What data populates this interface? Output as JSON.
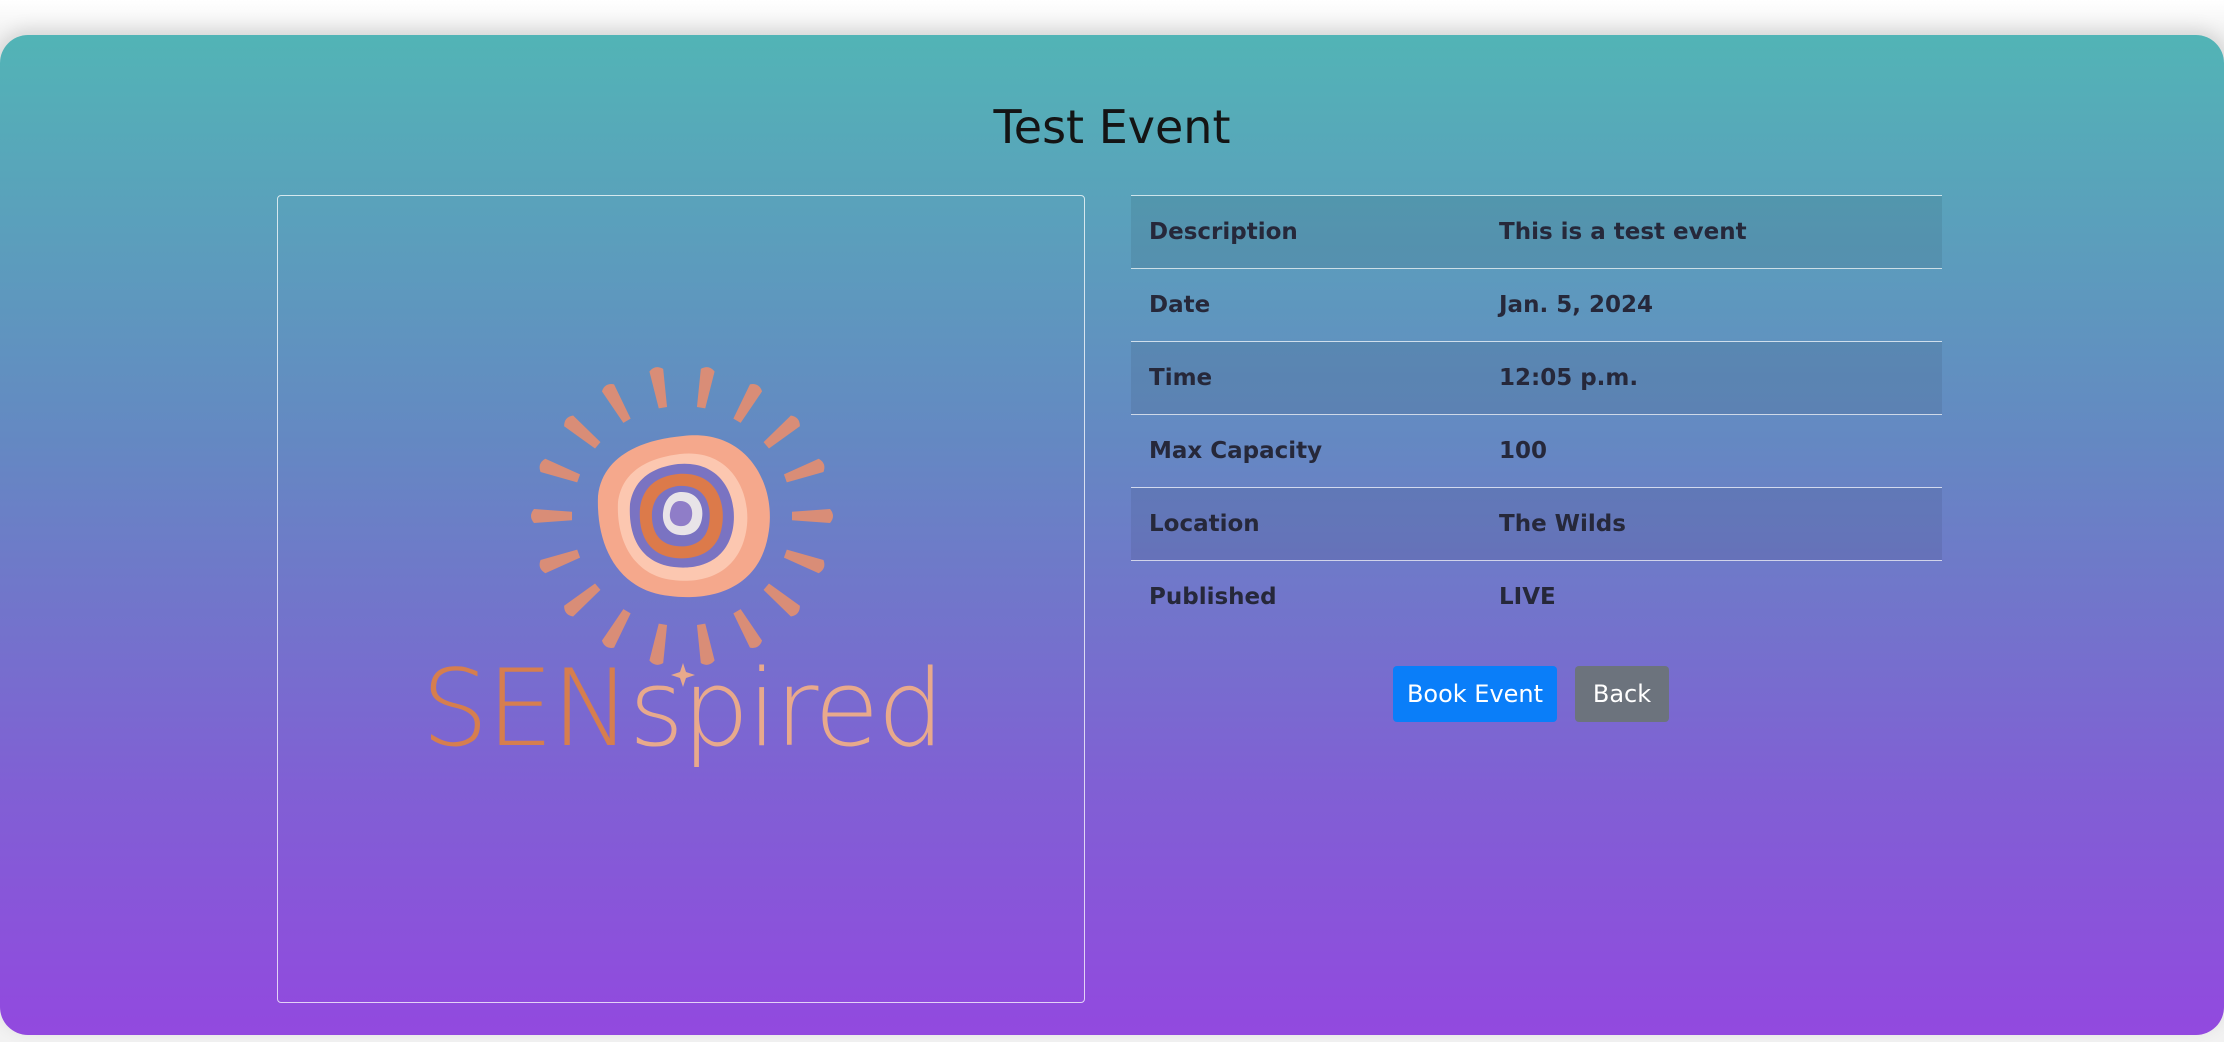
{
  "event": {
    "title": "Test Event"
  },
  "logo": {
    "text_part1": "SEN",
    "text_part2": "spired",
    "icon": "sun-logo-icon"
  },
  "details": [
    {
      "label": "Description",
      "value": "This is a test event"
    },
    {
      "label": "Date",
      "value": "Jan. 5, 2024"
    },
    {
      "label": "Time",
      "value": "12:05 p.m."
    },
    {
      "label": "Max Capacity",
      "value": "100"
    },
    {
      "label": "Location",
      "value": "The Wilds"
    },
    {
      "label": "Published",
      "value": "LIVE"
    }
  ],
  "actions": {
    "book_label": "Book Event",
    "back_label": "Back"
  },
  "colors": {
    "gradient_top": "#52b4b6",
    "gradient_bottom": "#9249df",
    "primary_button": "#0a7ef9",
    "secondary_button": "#6c737d"
  }
}
